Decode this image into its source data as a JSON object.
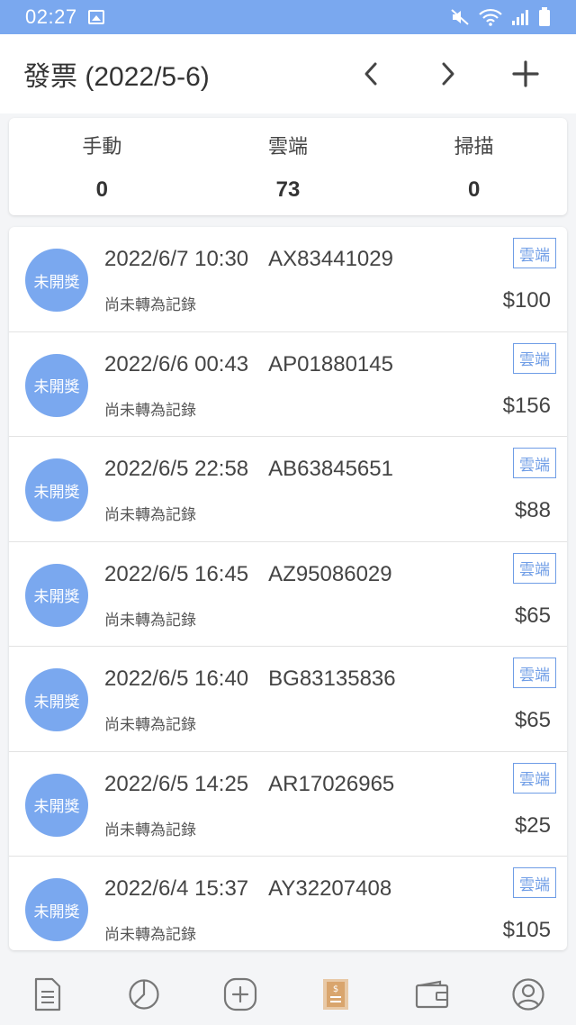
{
  "status_bar": {
    "time": "02:27"
  },
  "header": {
    "title": "發票 (2022/5-6)"
  },
  "summary": [
    {
      "label": "手動",
      "value": "0"
    },
    {
      "label": "雲端",
      "value": "73"
    },
    {
      "label": "掃描",
      "value": "0"
    }
  ],
  "invoices": [
    {
      "badge": "未開獎",
      "datetime": "2022/6/7 10:30",
      "number": "AX83441029",
      "status": "尚未轉為記錄",
      "source": "雲端",
      "amount": "$100"
    },
    {
      "badge": "未開獎",
      "datetime": "2022/6/6 00:43",
      "number": "AP01880145",
      "status": "尚未轉為記錄",
      "source": "雲端",
      "amount": "$156"
    },
    {
      "badge": "未開獎",
      "datetime": "2022/6/5 22:58",
      "number": "AB63845651",
      "status": "尚未轉為記錄",
      "source": "雲端",
      "amount": "$88"
    },
    {
      "badge": "未開獎",
      "datetime": "2022/6/5 16:45",
      "number": "AZ95086029",
      "status": "尚未轉為記錄",
      "source": "雲端",
      "amount": "$65"
    },
    {
      "badge": "未開獎",
      "datetime": "2022/6/5 16:40",
      "number": "BG83135836",
      "status": "尚未轉為記錄",
      "source": "雲端",
      "amount": "$65"
    },
    {
      "badge": "未開獎",
      "datetime": "2022/6/5 14:25",
      "number": "AR17026965",
      "status": "尚未轉為記錄",
      "source": "雲端",
      "amount": "$25"
    },
    {
      "badge": "未開獎",
      "datetime": "2022/6/4 15:37",
      "number": "AY32207408",
      "status": "尚未轉為記錄",
      "source": "雲端",
      "amount": "$105"
    }
  ],
  "bottom_nav": [
    {
      "icon": "list-document-icon"
    },
    {
      "icon": "pie-chart-icon"
    },
    {
      "icon": "add-circle-icon"
    },
    {
      "icon": "receipt-icon",
      "active": true
    },
    {
      "icon": "wallet-icon"
    },
    {
      "icon": "profile-icon"
    }
  ],
  "colors": {
    "accent": "#7aa8ef",
    "tag": "#6f9de6"
  }
}
